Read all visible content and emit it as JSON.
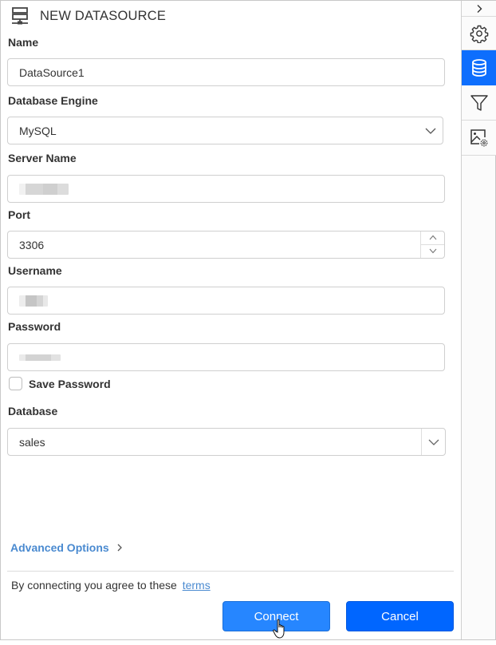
{
  "header": {
    "title": "NEW DATASOURCE",
    "icon": "datasource-server-icon"
  },
  "form": {
    "name": {
      "label": "Name",
      "value": "DataSource1"
    },
    "database_engine": {
      "label": "Database Engine",
      "value": "MySQL"
    },
    "server_name": {
      "label": "Server Name",
      "value": "[redacted]"
    },
    "port": {
      "label": "Port",
      "value": "3306"
    },
    "username": {
      "label": "Username",
      "value": "[redacted]"
    },
    "password": {
      "label": "Password",
      "value": "[redacted]"
    },
    "save_password": {
      "label": "Save Password",
      "checked": false
    },
    "database": {
      "label": "Database",
      "value": "sales"
    }
  },
  "advanced_options": {
    "label": "Advanced Options"
  },
  "terms": {
    "text": "By connecting you agree to these",
    "link": "terms"
  },
  "buttons": {
    "connect": "Connect",
    "cancel": "Cancel"
  },
  "toolbar": {
    "items": [
      {
        "name": "collapse",
        "icon": "chevron-right-icon",
        "active": false
      },
      {
        "name": "settings",
        "icon": "gear-icon",
        "active": false
      },
      {
        "name": "datasource",
        "icon": "database-icon",
        "active": true
      },
      {
        "name": "filter",
        "icon": "filter-icon",
        "active": false
      },
      {
        "name": "image-settings",
        "icon": "image-settings-icon",
        "active": false
      }
    ]
  },
  "colors": {
    "accent": "#0d6efd",
    "connect_button": "#2686ff",
    "cancel_button": "#0066ff",
    "link": "#4a8ad0"
  }
}
